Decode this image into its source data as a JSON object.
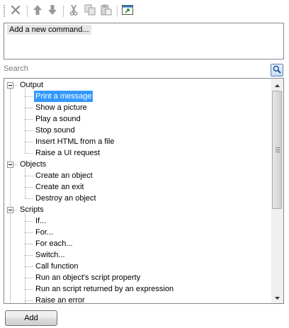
{
  "toolbar": {
    "buttons": [
      {
        "name": "delete-button",
        "icon": "delete-x-icon"
      },
      {
        "name": "move-up-button",
        "icon": "arrow-up-icon"
      },
      {
        "name": "move-down-button",
        "icon": "arrow-down-icon"
      },
      {
        "name": "cut-button",
        "icon": "scissors-icon"
      },
      {
        "name": "copy-button",
        "icon": "copy-icon"
      },
      {
        "name": "paste-button",
        "icon": "paste-icon"
      },
      {
        "name": "pop-out-button",
        "icon": "pop-out-icon"
      }
    ]
  },
  "command_list": {
    "items": [
      "Add a new command..."
    ]
  },
  "search": {
    "label": "Search",
    "icon": "magnifier-icon"
  },
  "tree": {
    "categories": [
      {
        "label": "Output",
        "expanded": true,
        "items": [
          "Print a message",
          "Show a picture",
          "Play a sound",
          "Stop sound",
          "Insert HTML from a file",
          "Raise a UI request"
        ]
      },
      {
        "label": "Objects",
        "expanded": true,
        "items": [
          "Create an object",
          "Create an exit",
          "Destroy an object"
        ]
      },
      {
        "label": "Scripts",
        "expanded": true,
        "items": [
          "If...",
          "For...",
          "For each...",
          "Switch...",
          "Call function",
          "Run an object's script property",
          "Run an script returned by an expression",
          "Raise an error"
        ]
      }
    ],
    "selected": "Print a message"
  },
  "colors": {
    "selection": "#3399ff",
    "border": "#828790"
  },
  "add_button": {
    "label": "Add"
  }
}
